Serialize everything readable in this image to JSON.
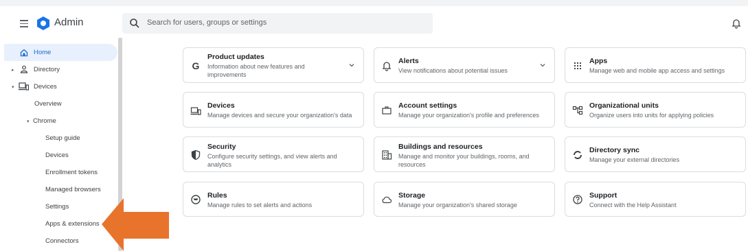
{
  "header": {
    "app_title": "Admin",
    "search_placeholder": "Search for users, groups or settings"
  },
  "sidebar": {
    "items": [
      {
        "label": "Home"
      },
      {
        "label": "Directory"
      },
      {
        "label": "Devices"
      },
      {
        "label": "Overview"
      },
      {
        "label": "Chrome"
      },
      {
        "label": "Setup guide"
      },
      {
        "label": "Devices"
      },
      {
        "label": "Enrollment tokens"
      },
      {
        "label": "Managed browsers"
      },
      {
        "label": "Settings"
      },
      {
        "label": "Apps & extensions"
      },
      {
        "label": "Connectors"
      }
    ]
  },
  "cards": [
    {
      "title": "Product updates",
      "description": "Information about new features and improvements",
      "icon": "google-g-icon"
    },
    {
      "title": "Alerts",
      "description": "View notifications about potential issues",
      "icon": "bell-icon"
    },
    {
      "title": "Apps",
      "description": "Manage web and mobile app access and settings",
      "icon": "apps-grid-icon"
    },
    {
      "title": "Devices",
      "description": "Manage devices and secure your organization's data",
      "icon": "devices-icon"
    },
    {
      "title": "Account settings",
      "description": "Manage your organization's profile and preferences",
      "icon": "briefcase-icon"
    },
    {
      "title": "Organizational units",
      "description": "Organize users into units for applying policies",
      "icon": "org-units-icon"
    },
    {
      "title": "Security",
      "description": "Configure security settings, and view alerts and analytics",
      "icon": "shield-icon"
    },
    {
      "title": "Buildings and resources",
      "description": "Manage and monitor your buildings, rooms, and resources",
      "icon": "building-icon"
    },
    {
      "title": "Directory sync",
      "description": "Manage your external directories",
      "icon": "sync-icon"
    },
    {
      "title": "Rules",
      "description": "Manage rules to set alerts and actions",
      "icon": "rules-icon"
    },
    {
      "title": "Storage",
      "description": "Manage your organization's shared storage",
      "icon": "cloud-icon"
    },
    {
      "title": "Support",
      "description": "Connect with the Help Assistant",
      "icon": "help-icon"
    }
  ],
  "colors": {
    "accent": "#1967d2",
    "active_bg": "#e8f0fe",
    "callout_arrow": "#e8732a",
    "logo": "#1a73e8"
  }
}
